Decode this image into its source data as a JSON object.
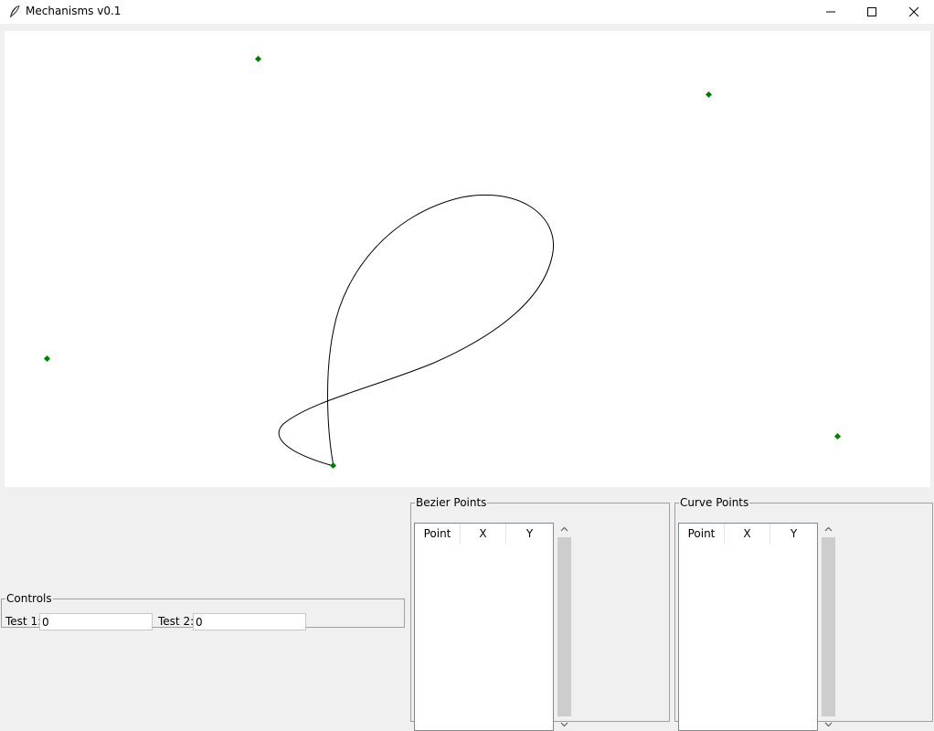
{
  "window": {
    "title": "Mechanisms v0.1",
    "icon": "feather-icon",
    "buttons": [
      "minimize-icon",
      "maximize-icon",
      "close-icon"
    ]
  },
  "canvas": {
    "background": "#ffffff",
    "curve_color": "#000000",
    "control_point_color": "#008000"
  },
  "controls": {
    "legend": "Controls",
    "test1_label": "Test 1:",
    "test1_value": "0",
    "test2_label": "Test 2:",
    "test2_value": "0"
  },
  "bezier_points": {
    "legend": "Bezier Points",
    "columns": [
      "Point",
      "X",
      "Y"
    ],
    "rows": []
  },
  "curve_points": {
    "legend": "Curve Points",
    "columns": [
      "Point",
      "X",
      "Y"
    ],
    "rows": []
  }
}
